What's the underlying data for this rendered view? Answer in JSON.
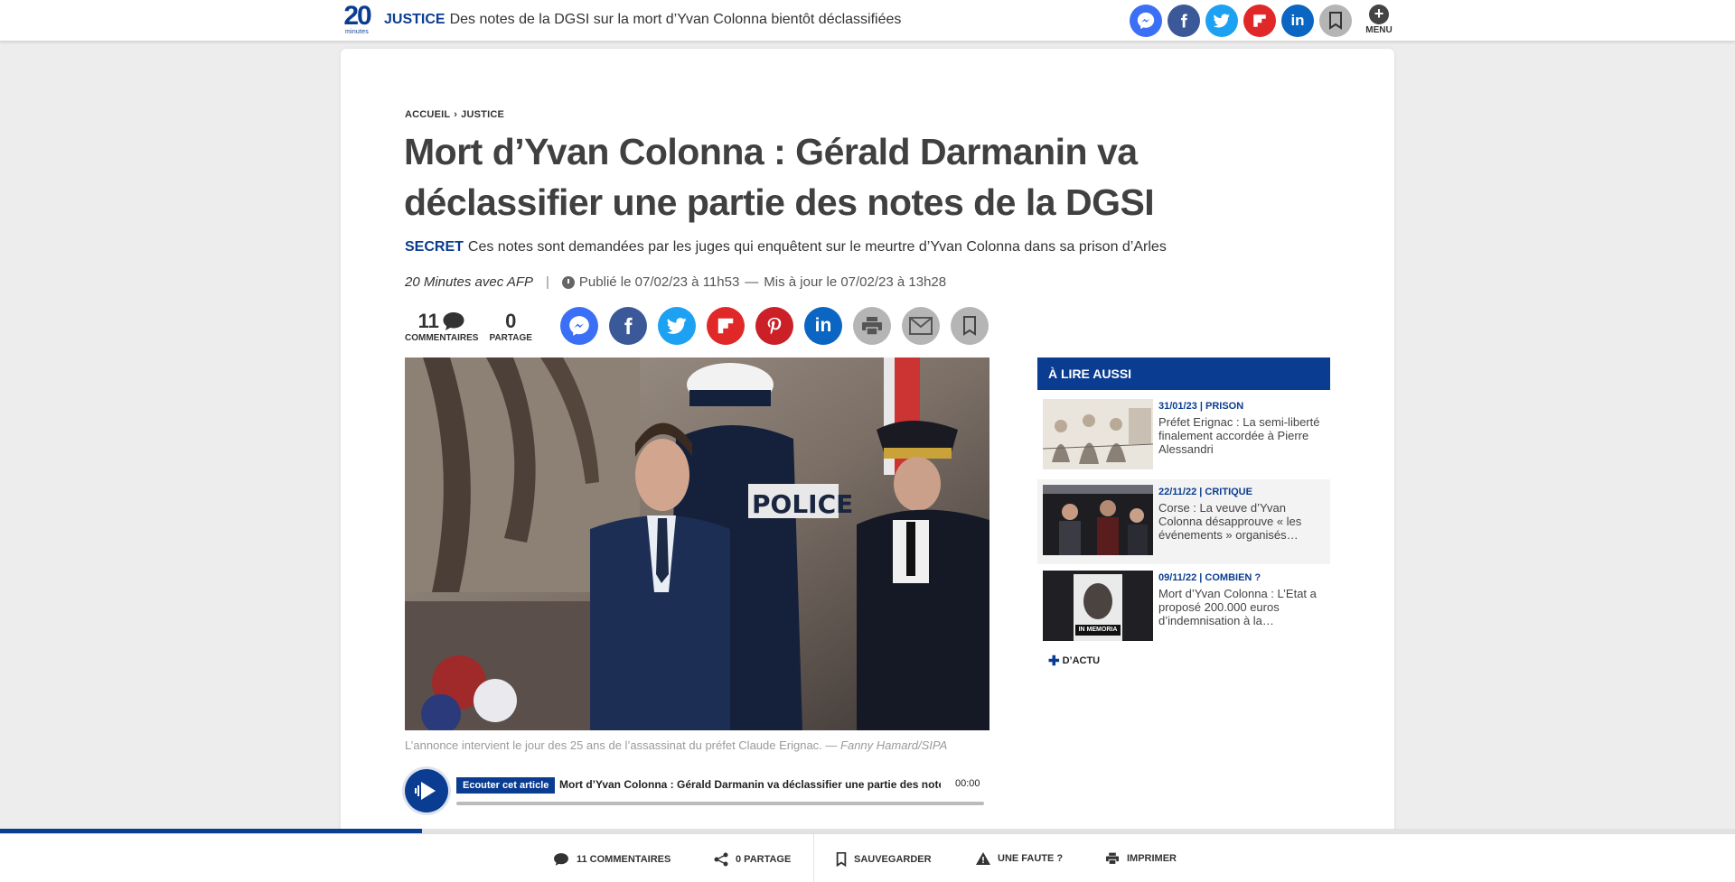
{
  "header": {
    "logo_number": "20",
    "logo_text": "minutes",
    "rubric": "JUSTICE",
    "title": "Des notes de la DGSI sur la mort d’Yvan Colonna bientôt déclassifiées",
    "menu_label": "MENU"
  },
  "breadcrumb": [
    "ACCUEIL",
    "JUSTICE"
  ],
  "article": {
    "title": "Mort d’Yvan Colonna : Gérald Darmanin va déclassifier une partie des notes de la DGSI",
    "lead_keyword": "SECRET",
    "lead_text": "Ces notes sont demandées par les juges qui enquêtent sur le meurtre d’Yvan Colonna dans sa prison d’Arles",
    "author": "20 Minutes avec AFP",
    "published": "Publié le 07/02/23 à 11h53",
    "updated": "Mis à jour le 07/02/23 à 13h28",
    "comments_count": "11",
    "comments_label": "COMMENTAIRES",
    "shares_count": "0",
    "shares_label": "PARTAGE",
    "photo_badge": "POLICE",
    "caption": "L’annonce intervient le jour des 25 ans de l’assassinat du préfet Claude Erignac.",
    "caption_credit": "Fanny Hamard/SIPA"
  },
  "player": {
    "tag": "Ecouter cet article",
    "title": "Mort d’Yvan Colonna : Gérald Darmanin va déclassifier une partie des notes de la DGSI",
    "time": "00:00"
  },
  "aside": {
    "heading": "À LIRE AUSSI",
    "items": [
      {
        "meta": "31/01/23 | PRISON",
        "text": "Préfet Erignac : La semi-liberté finalement accordée à Pierre Alessandri"
      },
      {
        "meta": "22/11/22 | CRITIQUE",
        "text": "Corse : La veuve d’Yvan Colonna désapprouve « les événements » organisés…"
      },
      {
        "meta": "09/11/22 | COMBIEN ?",
        "text": "Mort d’Yvan Colonna : L’Etat a proposé 200.000 euros d’indemnisation à la…",
        "thumb_banner": "IN MEMORIA"
      }
    ],
    "more_label": "D’ACTU"
  },
  "reading_progress": 0.243,
  "bottom_bar": {
    "comments": "11 COMMENTAIRES",
    "share": "0 PARTAGE",
    "save": "SAUVEGARDER",
    "error": "UNE FAUTE ?",
    "print": "IMPRIMER"
  },
  "colors": {
    "brand": "#0a3d91",
    "messenger": "#3b6ff5",
    "facebook": "#3b5998",
    "twitter": "#1da1f2",
    "flipboard": "#e12828",
    "pinterest": "#cb2027",
    "linkedin": "#0a66c2",
    "neutral_icon": "#b5b5b5"
  }
}
